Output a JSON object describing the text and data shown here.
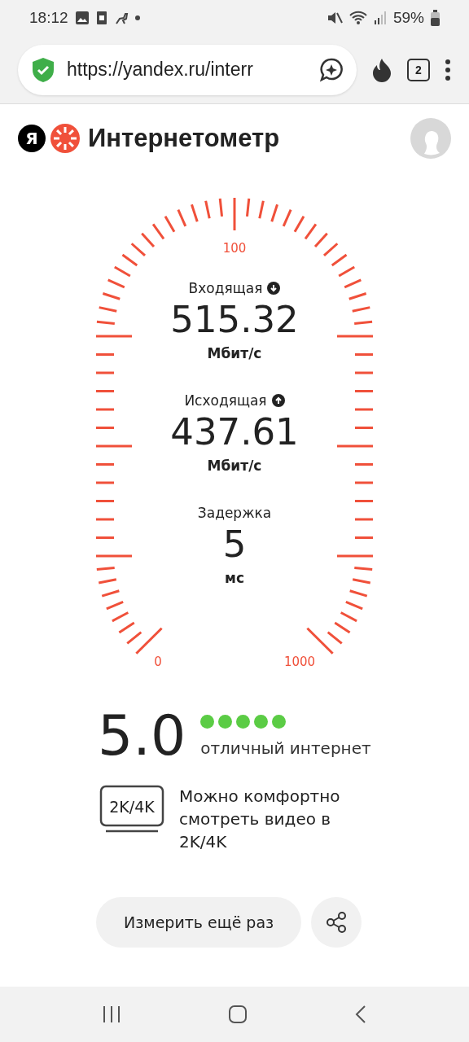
{
  "status_bar": {
    "time": "18:12",
    "battery": "59%"
  },
  "browser": {
    "url": "https://yandex.ru/interr",
    "tab_count": "2"
  },
  "header": {
    "logo_letter": "Я",
    "title": "Интернетометр"
  },
  "gauge": {
    "scale_labels": [
      "100",
      "0",
      "1000"
    ]
  },
  "metrics": [
    {
      "kind": "download",
      "label": "Входящая",
      "value": "515.32",
      "unit": "Мбит/с"
    },
    {
      "kind": "upload",
      "label": "Исходящая",
      "value": "437.61",
      "unit": "Мбит/с"
    },
    {
      "kind": "plain",
      "label": "Задержка",
      "value": "5",
      "unit": "мс"
    }
  ],
  "rating": {
    "score": "5.0",
    "stars": 5,
    "verdict": "отличный интернет"
  },
  "video": {
    "badge": "2K/4K",
    "text": "Можно комфортно смотреть видео в 2K/4K"
  },
  "actions": {
    "retest": "Измерить ещё раз"
  }
}
